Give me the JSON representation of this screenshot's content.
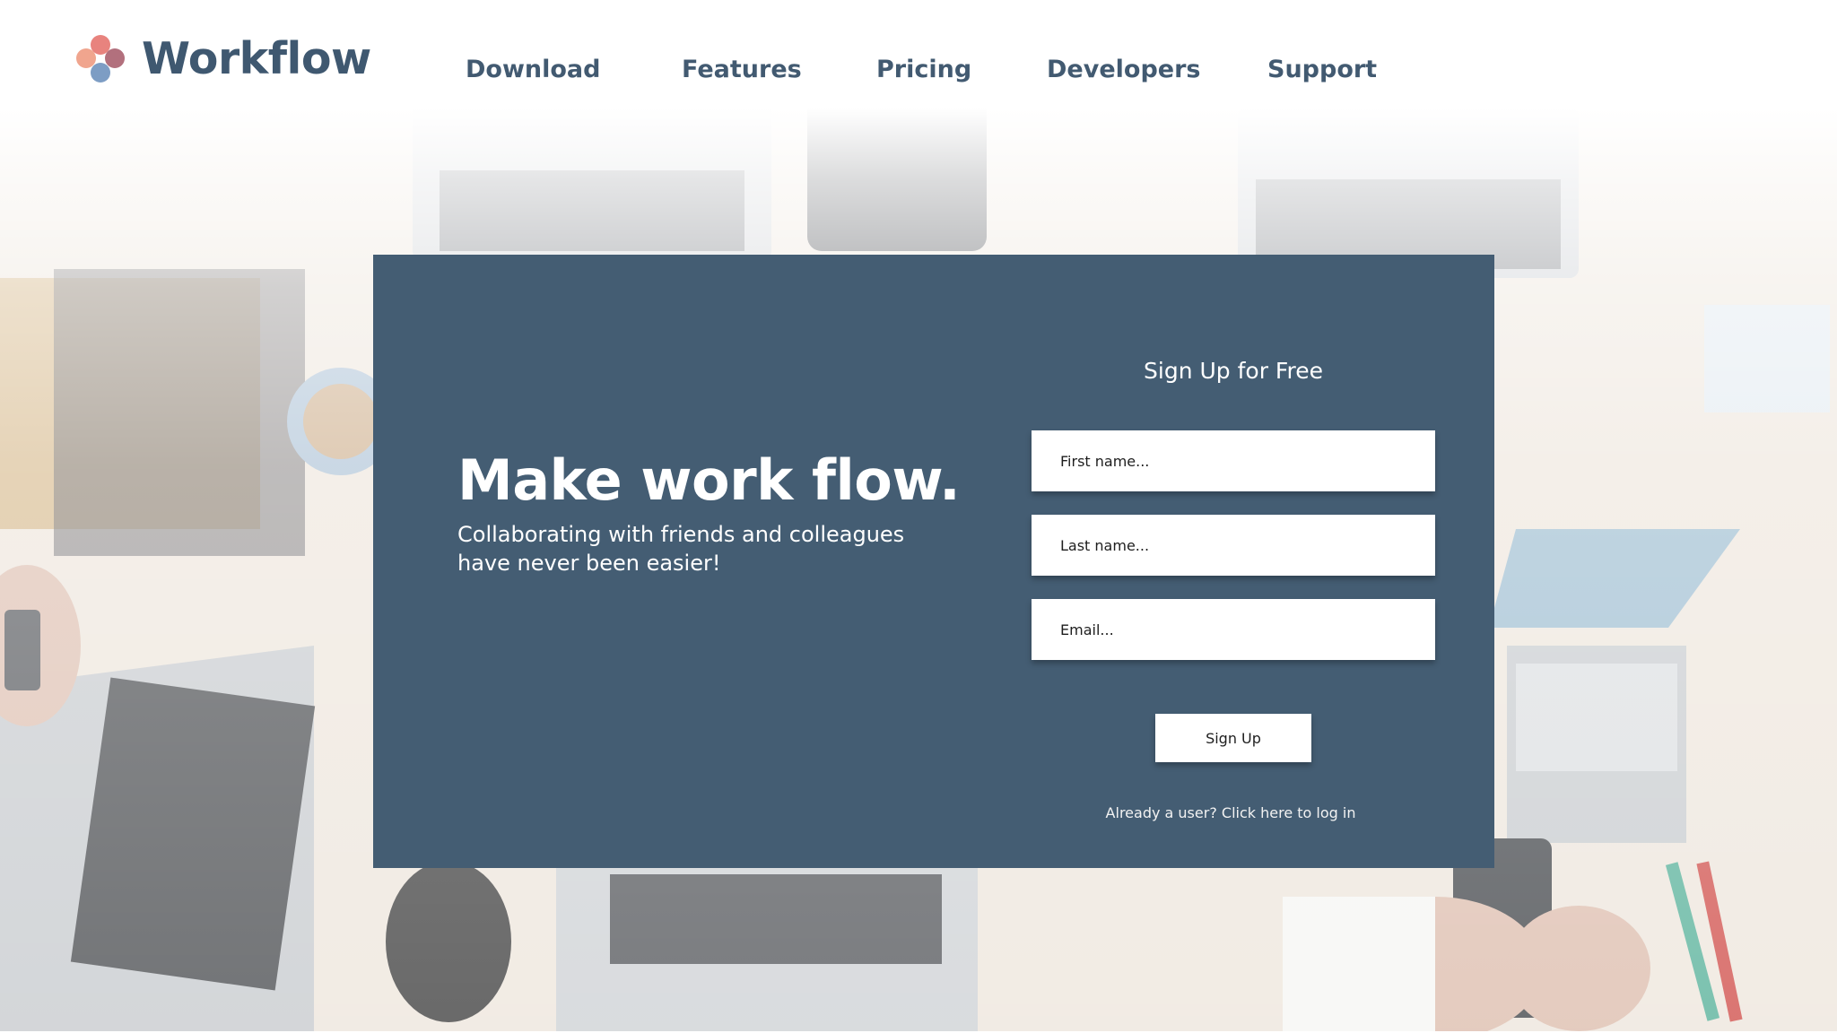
{
  "brand": {
    "name": "Workflow",
    "logo_colors": [
      "#e8837e",
      "#b2707d",
      "#7d9dc4",
      "#f0a58e"
    ]
  },
  "nav": {
    "items": [
      {
        "label": "Download"
      },
      {
        "label": "Features"
      },
      {
        "label": "Pricing"
      },
      {
        "label": "Developers"
      },
      {
        "label": "Support"
      }
    ]
  },
  "hero": {
    "headline": "Make work flow.",
    "subline": "Collaborating with friends and colleagues have never been easier!"
  },
  "signup": {
    "title": "Sign Up for Free",
    "first_name_placeholder": "First name...",
    "last_name_placeholder": "Last name...",
    "email_placeholder": "Email...",
    "button_label": "Sign Up",
    "login_link": "Already a user? Click here to log in"
  },
  "colors": {
    "card": "#445d73",
    "nav_text": "#425a71"
  }
}
